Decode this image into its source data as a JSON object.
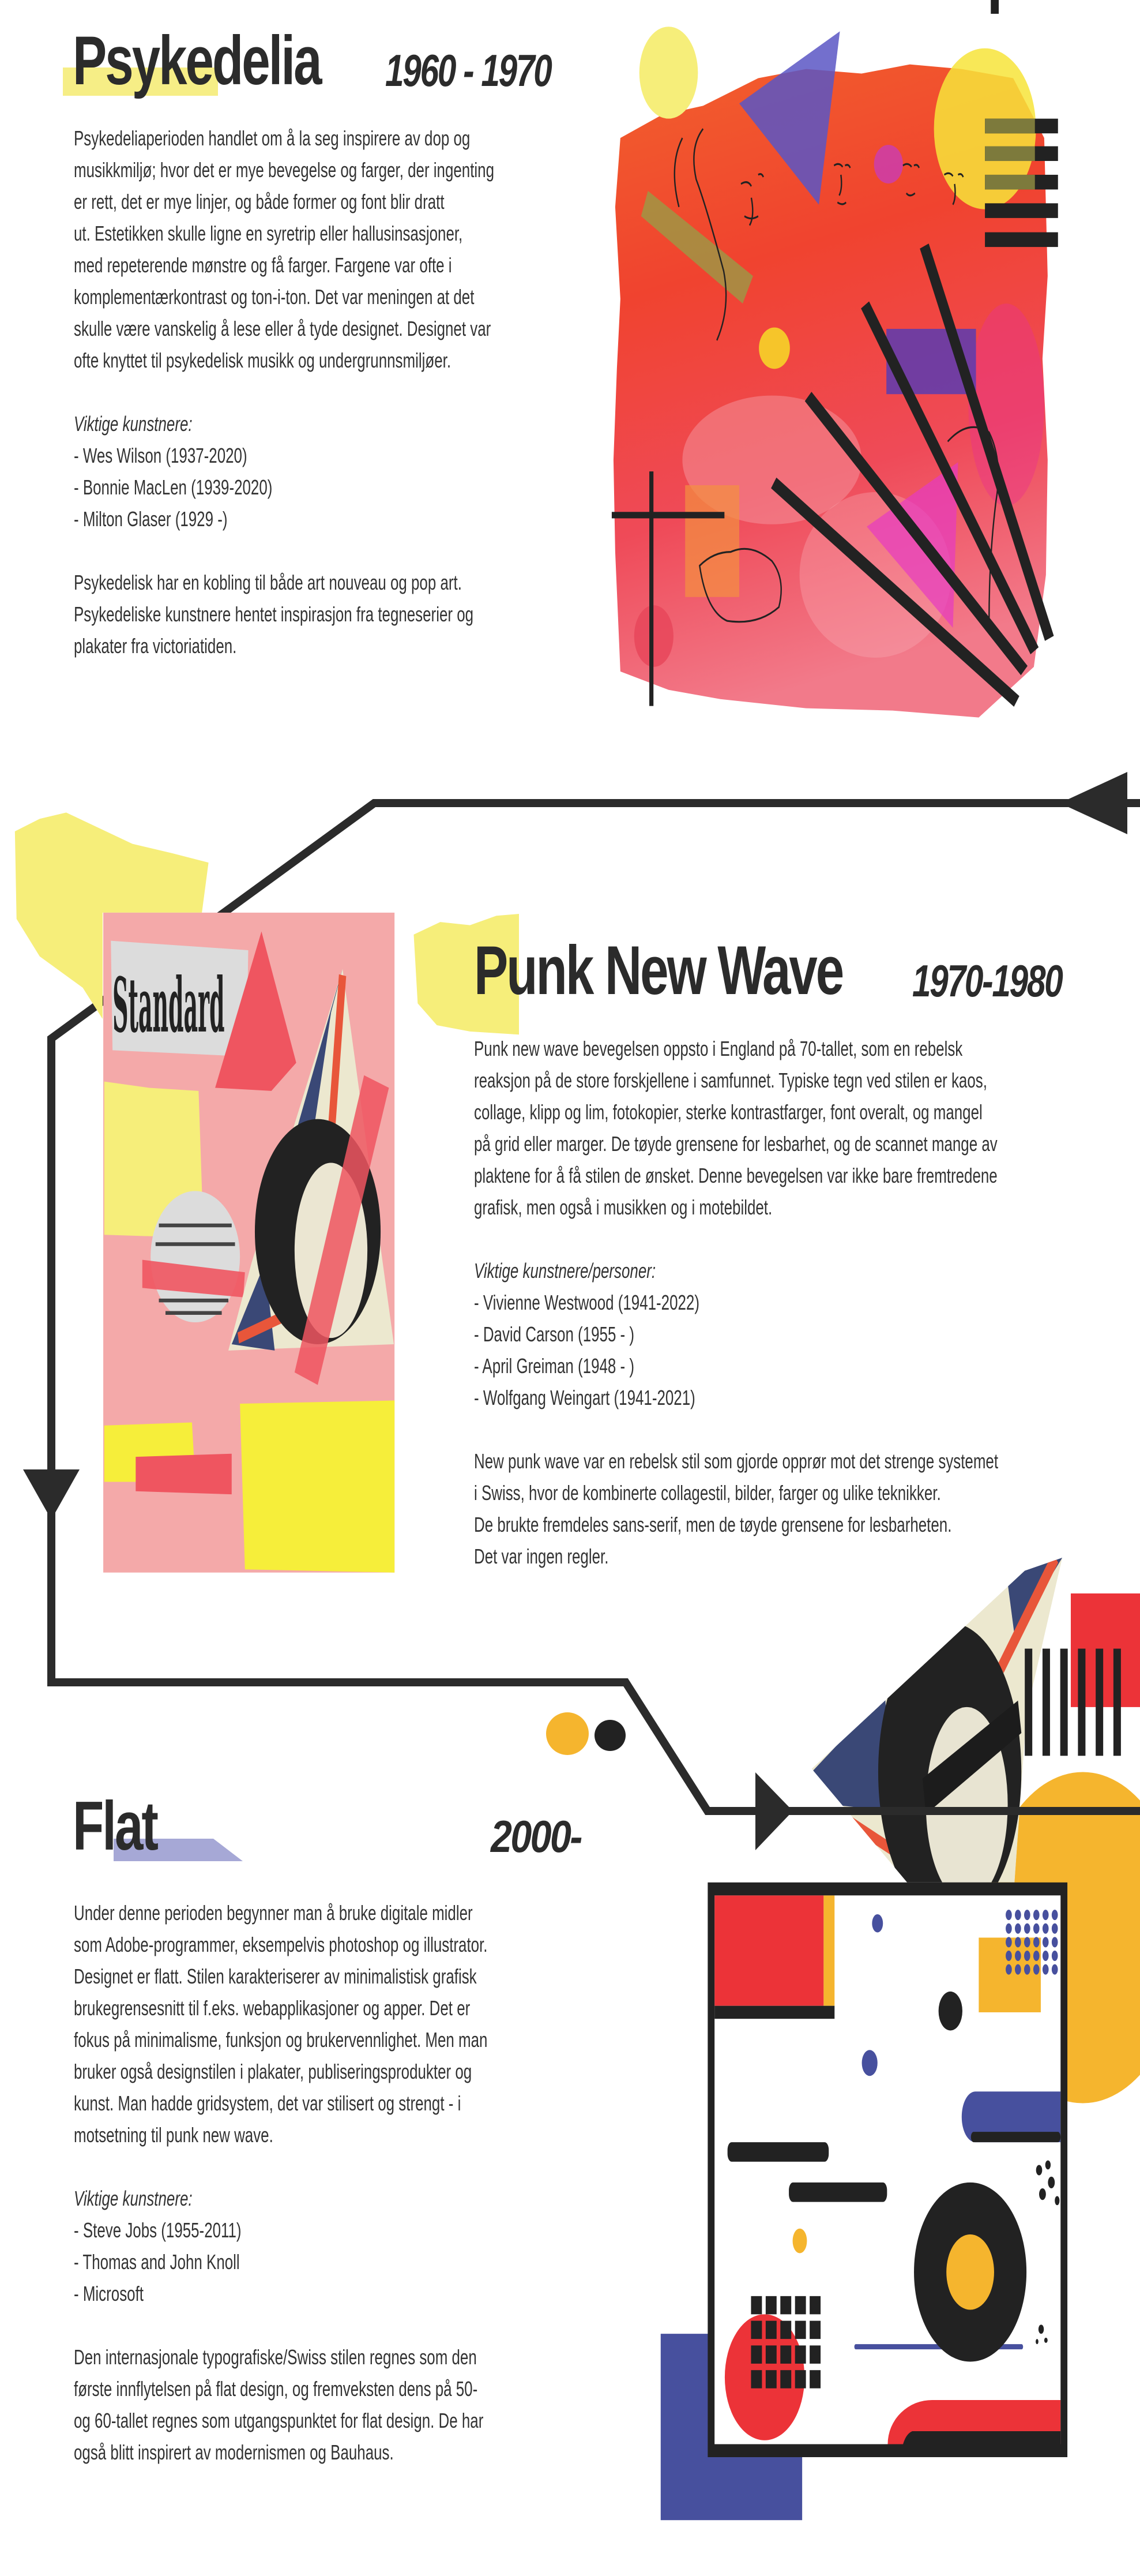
{
  "sections": {
    "psykedelia": {
      "title": "Psykedelia",
      "period": "1960 - 1970",
      "intro": [
        "Psykedeliaperioden handlet om å la seg inspirere av dop og",
        "musikkmiljø; hvor det er mye bevegelse og farger, der ingenting",
        "er rett, det er mye linjer, og både former og font blir dratt",
        "ut. Estetikken skulle ligne en syretrip eller hallusinsasjoner,",
        "med repeterende mønstre og få farger. Fargene var ofte i",
        "komplementærkontrast og ton-i-ton. Det var meningen at det",
        "skulle være vanskelig å lese eller å tyde designet. Designet var",
        "ofte knyttet til psykedelisk musikk og undergrunnsmiljøer."
      ],
      "artists_heading": "Viktige kunstnere:",
      "artists": [
        "- Wes Wilson (1937-2020)",
        "- Bonnie MacLen (1939-2020)",
        "- Milton Glaser (1929 -)"
      ],
      "outro": [
        "Psykedelisk har en kobling til både art nouveau og pop art.",
        "Psykedeliske kunstnere hentet inspirasjon fra tegneserier og",
        "plakater fra victoriatiden."
      ]
    },
    "punk": {
      "title": "Punk New Wave",
      "period": "1970-1980",
      "intro": [
        "Punk new wave bevegelsen oppsto i England på 70-tallet, som en rebelsk",
        "reaksjon på de store forskjellene i samfunnet. Typiske tegn ved stilen er kaos,",
        "collage, klipp og lim, fotokopier, sterke kontrastfarger, font overalt, og mangel",
        "på grid eller marger. De tøyde grensene for lesbarhet, og de scannet mange av",
        "plaktene for å få stilen de ønsket. Denne bevegelsen var ikke bare fremtredene",
        "grafisk, men også i musikken og i motebildet."
      ],
      "artists_heading": "Viktige kunstnere/personer:",
      "artists": [
        "- Vivienne Westwood (1941-2022)",
        "- David Carson (1955 - )",
        "- April Greiman (1948 - )",
        "- Wolfgang Weingart (1941-2021)"
      ],
      "outro": [
        "New punk wave var en rebelsk stil som gjorde opprør mot det strenge systemet",
        "i Swiss, hvor de kombinerte collagestil, bilder, farger og ulike teknikker.",
        "De brukte fremdeles sans-serif, men de tøyde grensene for lesbarheten.",
        "Det var ingen regler."
      ],
      "collage_newspaper_text": "Standard"
    },
    "flat": {
      "title": "Flat",
      "period": "2000-",
      "intro": [
        "Under denne perioden begynner man å bruke digitale midler",
        "som Adobe-programmer, eksempelvis photoshop og illustrator.",
        "Designet er flatt. Stilen karakteriserer av minimalistisk grafisk",
        "brukegrensesnitt til f.eks. webapplikasjoner og apper. Det er",
        "fokus på minimalisme, funksjon og brukervennlighet. Men man",
        "bruker også designstilen i plakater, publiseringsprodukter og",
        "kunst. Man hadde gridsystem, det var stilisert og strengt - i",
        "motsetning til punk new wave."
      ],
      "artists_heading": "Viktige kunstnere:",
      "artists": [
        "- Steve Jobs (1955-2011)",
        "- Thomas and John Knoll",
        "-  Microsoft"
      ],
      "outro": [
        "Den internasjonale typografiske/Swiss stilen regnes som den",
        "første innflytelsen på flat design, og fremveksten dens på 50-",
        "og 60-tallet regnes som utgangspunktet for flat design. De har",
        "også blitt inspirert av modernismen og Bauhaus."
      ]
    }
  },
  "colors": {
    "text": "#2b2b2b",
    "highlight_yellow": "#f6ee86",
    "highlight_blue": "#a6a8d6",
    "bauhaus_red": "#ec3338",
    "bauhaus_yellow": "#f5b52e",
    "bauhaus_blue": "#47509e",
    "collage_pink": "#f4a9a9"
  },
  "icons": [
    "arrow-left-icon",
    "arrow-down-icon",
    "arrow-right-icon"
  ]
}
